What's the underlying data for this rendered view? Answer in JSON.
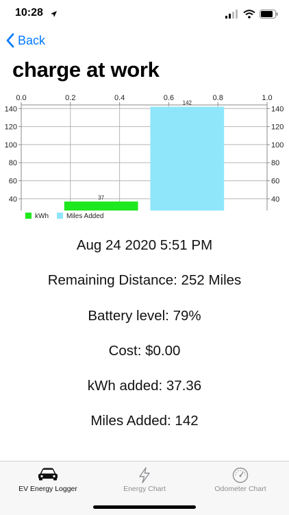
{
  "status_bar": {
    "time": "10:28"
  },
  "nav": {
    "back_label": "Back"
  },
  "page": {
    "title": "charge at work"
  },
  "chart_data": {
    "type": "bar",
    "x_ticks": [
      "0.0",
      "0.2",
      "0.4",
      "0.6",
      "0.8",
      "1.0"
    ],
    "xlim": [
      0,
      1
    ],
    "ylim": [
      27,
      144
    ],
    "y_ticks": [
      40,
      60,
      80,
      100,
      120,
      140
    ],
    "bars": [
      {
        "name": "kWh",
        "x_start": 0.175,
        "x_end": 0.475,
        "value": 37,
        "label": "37",
        "color": "#1ee81e"
      },
      {
        "name": "Miles Added",
        "x_start": 0.525,
        "x_end": 0.825,
        "value": 142,
        "label": "142",
        "color": "#8fe6fb"
      }
    ],
    "legend": [
      {
        "label": "kWh",
        "color": "#1ee81e"
      },
      {
        "label": "Miles Added",
        "color": "#8fe6fb"
      }
    ],
    "grid": true,
    "legend_position": "bottom-left"
  },
  "details": {
    "date": "Aug 24 2020 5:51 PM",
    "remaining": "Remaining Distance: 252 Miles",
    "battery": "Battery level: 79%",
    "cost": "Cost: $0.00",
    "kwh": "kWh added: 37.36",
    "miles": "Miles Added: 142"
  },
  "tabs": [
    {
      "label": "EV Energy Logger",
      "icon": "car-icon",
      "active": true
    },
    {
      "label": "Energy Chart",
      "icon": "bolt-icon",
      "active": false
    },
    {
      "label": "Odometer Chart",
      "icon": "speedometer-icon",
      "active": false
    }
  ],
  "colors": {
    "accent": "#007aff",
    "active_tab": "#111111",
    "inactive_tab": "#8e8e93"
  }
}
